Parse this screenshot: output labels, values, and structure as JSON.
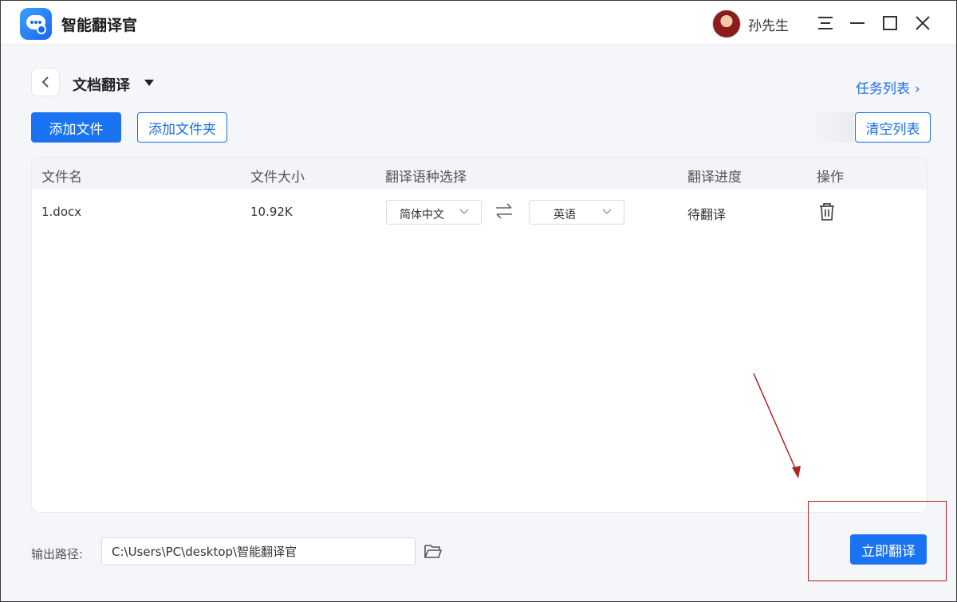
{
  "app": {
    "title": "智能翻译官",
    "user_name": "孙先生"
  },
  "window_controls": {
    "icons": [
      "menu-icon",
      "minimize-icon",
      "maximize-icon",
      "close-icon"
    ]
  },
  "header": {
    "page_title": "文档翻译",
    "task_link": "任务列表",
    "task_link_chevron": "›"
  },
  "toolbar": {
    "add_file": "添加文件",
    "add_folder": "添加文件夹",
    "clear_list": "清空列表"
  },
  "table": {
    "columns": [
      "文件名",
      "文件大小",
      "翻译语种选择",
      "翻译进度",
      "操作"
    ],
    "rows": [
      {
        "file_name": "1.docx",
        "file_size": "10.92K",
        "source_lang": "简体中文",
        "target_lang": "英语",
        "progress": "待翻译",
        "action_icon": "trash-icon"
      }
    ]
  },
  "output": {
    "label": "输出路径:",
    "path": "C:\\Users\\PC\\desktop\\智能翻译官"
  },
  "actions": {
    "translate_now": "立即翻译"
  },
  "colors": {
    "primary": "#1a73f0",
    "annotation": "#b22222"
  }
}
